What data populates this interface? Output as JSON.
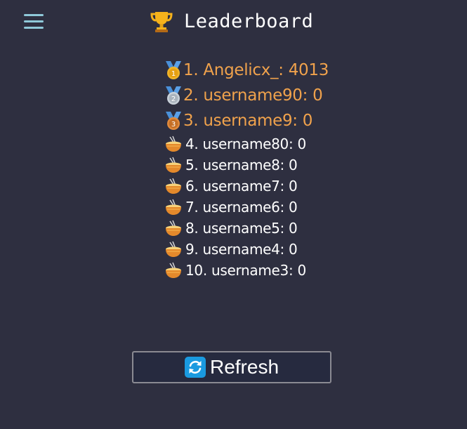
{
  "header": {
    "title": "Leaderboard",
    "menu_icon": "hamburger-menu-icon",
    "title_icon": "trophy-icon"
  },
  "leaderboard": {
    "top_entries": [
      {
        "label": "1. Angelicx_: 4013",
        "icon": "gold-medal-icon"
      },
      {
        "label": "2. username90: 0",
        "icon": "silver-medal-icon"
      },
      {
        "label": "3. username9: 0",
        "icon": "bronze-medal-icon"
      }
    ],
    "other_entries": [
      {
        "label": "4. username80: 0",
        "icon": "ramen-bowl-icon"
      },
      {
        "label": "5. username8: 0",
        "icon": "ramen-bowl-icon"
      },
      {
        "label": "6. username7: 0",
        "icon": "ramen-bowl-icon"
      },
      {
        "label": "7. username6: 0",
        "icon": "ramen-bowl-icon"
      },
      {
        "label": "8. username5: 0",
        "icon": "ramen-bowl-icon"
      },
      {
        "label": "9. username4: 0",
        "icon": "ramen-bowl-icon"
      },
      {
        "label": "10. username3: 0",
        "icon": "ramen-bowl-icon"
      }
    ]
  },
  "refresh_button": {
    "label": "Refresh",
    "icon": "refresh-icon"
  },
  "colors": {
    "background": "#2e2f40",
    "top_three_text": "#f0a24c",
    "menu_icon": "#8fc9d9",
    "refresh_icon_bg": "#1a9ae0",
    "button_border": "#8a8a92",
    "button_bg": "#262a3f"
  }
}
